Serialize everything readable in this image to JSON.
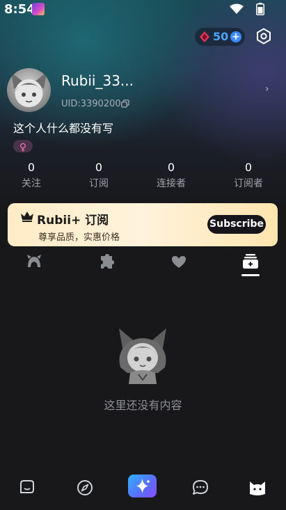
{
  "status_bar": {
    "time": "8:54"
  },
  "header": {
    "coin_count": "50"
  },
  "profile": {
    "username": "Rubii_33...",
    "uid": "UID:3390200",
    "bio": "这个人什么都没有写",
    "gender_symbol": "♀"
  },
  "stats": [
    {
      "value": "0",
      "label": "关注"
    },
    {
      "value": "0",
      "label": "订阅"
    },
    {
      "value": "0",
      "label": "连接者"
    },
    {
      "value": "0",
      "label": "订阅者"
    }
  ],
  "subscription_banner": {
    "title": "Rubii+ 订阅",
    "subtitle": "尊享品质，实惠价格",
    "button_label": "Subscribe"
  },
  "tabs": [
    {
      "icon": "character-icon"
    },
    {
      "icon": "puzzle-icon"
    },
    {
      "icon": "heart-icon"
    },
    {
      "icon": "archive-icon",
      "selected": true
    }
  ],
  "empty_state": {
    "message": "这里还没有内容"
  },
  "bottom_nav": [
    {
      "icon": "chat-bubble-icon"
    },
    {
      "icon": "compass-icon"
    },
    {
      "icon": "sparkle-icon",
      "highlighted": true
    },
    {
      "icon": "messages-icon"
    },
    {
      "icon": "cat-face-icon",
      "selected": true
    }
  ],
  "colors": {
    "accent_blue": "#4aa3ff",
    "banner_bg": "#fff3dc",
    "gender_pink": "#ff6fb1"
  }
}
